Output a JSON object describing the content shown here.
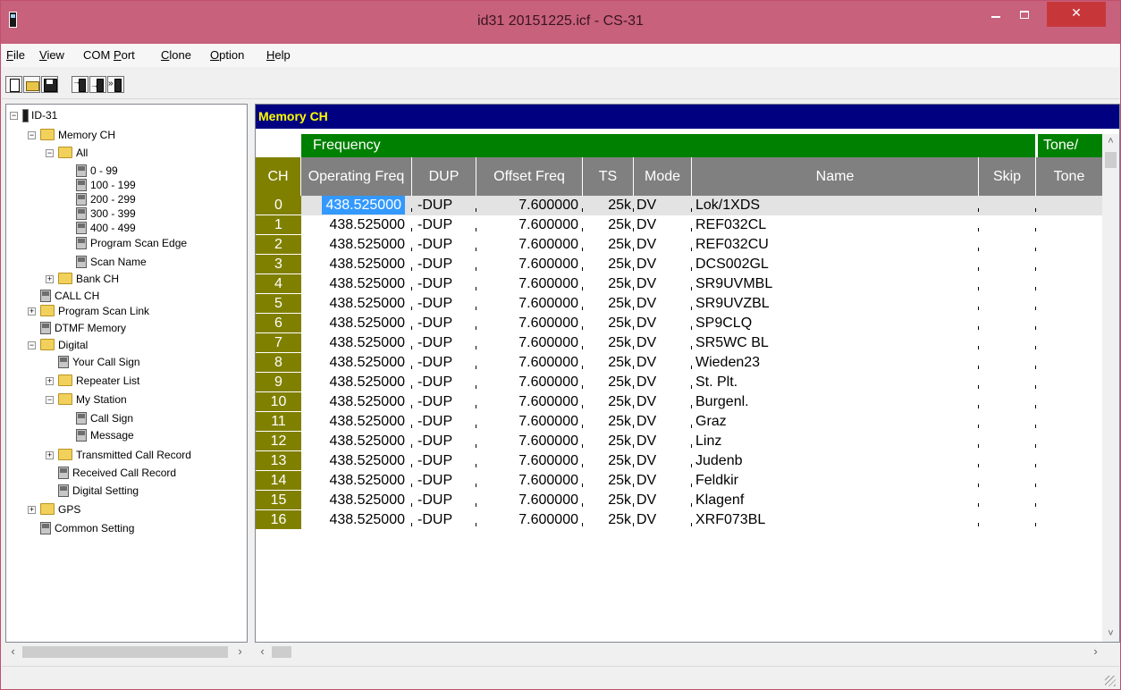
{
  "window": {
    "title": "id31 20151225.icf - CS-31"
  },
  "menu": [
    {
      "key": "F",
      "rest": "ile"
    },
    {
      "key": "V",
      "rest": "iew"
    },
    {
      "pre": "COM ",
      "key": "P",
      "rest": "ort"
    },
    {
      "key": "C",
      "rest": "lone"
    },
    {
      "key": "O",
      "rest": "ption"
    },
    {
      "key": "H",
      "rest": "elp"
    }
  ],
  "toolbar_icons": [
    "new-document-icon",
    "open-folder-icon",
    "save-disk-icon",
    "read-from-radio-icon",
    "write-to-radio-icon",
    "clone-radio-icon"
  ],
  "tree": [
    {
      "label": "ID-31",
      "icon": "radio",
      "expand": "-"
    },
    {
      "label": "Memory CH",
      "icon": "folder",
      "expand": "-"
    },
    {
      "label": "All",
      "icon": "folder",
      "expand": "-"
    },
    {
      "label": "0 - 99",
      "icon": "page"
    },
    {
      "label": "100 - 199",
      "icon": "page"
    },
    {
      "label": "200 - 299",
      "icon": "page"
    },
    {
      "label": "300 - 399",
      "icon": "page"
    },
    {
      "label": "400 - 499",
      "icon": "page"
    },
    {
      "label": "Program Scan Edge",
      "icon": "page"
    },
    {
      "label": "Scan Name",
      "icon": "page"
    },
    {
      "label": "Bank CH",
      "icon": "folder",
      "expand": "+"
    },
    {
      "label": "CALL CH",
      "icon": "page"
    },
    {
      "label": "Program Scan Link",
      "icon": "folder",
      "expand": "+"
    },
    {
      "label": "DTMF Memory",
      "icon": "page"
    },
    {
      "label": "Digital",
      "icon": "folder",
      "expand": "-"
    },
    {
      "label": "Your Call Sign",
      "icon": "page"
    },
    {
      "label": "Repeater List",
      "icon": "folder",
      "expand": "+"
    },
    {
      "label": "My Station",
      "icon": "folder",
      "expand": "-"
    },
    {
      "label": "Call Sign",
      "icon": "page"
    },
    {
      "label": "Message",
      "icon": "page"
    },
    {
      "label": "Transmitted Call Record",
      "icon": "folder",
      "expand": "+"
    },
    {
      "label": "Received Call Record",
      "icon": "page"
    },
    {
      "label": "Digital Setting",
      "icon": "page"
    },
    {
      "label": "GPS",
      "icon": "folder",
      "expand": "+"
    },
    {
      "label": "Common Setting",
      "icon": "page"
    }
  ],
  "panel": {
    "title": "Memory CH"
  },
  "grid": {
    "group_frequency": "Frequency",
    "group_tone": "Tone/",
    "columns": {
      "ch": "CH",
      "opfreq": "Operating Freq",
      "dup": "DUP",
      "offset": "Offset Freq",
      "ts": "TS",
      "mode": "Mode",
      "name": "Name",
      "skip": "Skip",
      "tone": "Tone"
    },
    "rows": [
      {
        "ch": "0",
        "freq": "438.525000",
        "dup": "-DUP",
        "offset": "7.600000",
        "ts": "25k",
        "mode": "DV",
        "name": "Lok/1XDS"
      },
      {
        "ch": "1",
        "freq": "438.525000",
        "dup": "-DUP",
        "offset": "7.600000",
        "ts": "25k",
        "mode": "DV",
        "name": "REF032CL"
      },
      {
        "ch": "2",
        "freq": "438.525000",
        "dup": "-DUP",
        "offset": "7.600000",
        "ts": "25k",
        "mode": "DV",
        "name": "REF032CU"
      },
      {
        "ch": "3",
        "freq": "438.525000",
        "dup": "-DUP",
        "offset": "7.600000",
        "ts": "25k",
        "mode": "DV",
        "name": "DCS002GL"
      },
      {
        "ch": "4",
        "freq": "438.525000",
        "dup": "-DUP",
        "offset": "7.600000",
        "ts": "25k",
        "mode": "DV",
        "name": "SR9UVMBL"
      },
      {
        "ch": "5",
        "freq": "438.525000",
        "dup": "-DUP",
        "offset": "7.600000",
        "ts": "25k",
        "mode": "DV",
        "name": "SR9UVZBL"
      },
      {
        "ch": "6",
        "freq": "438.525000",
        "dup": "-DUP",
        "offset": "7.600000",
        "ts": "25k",
        "mode": "DV",
        "name": "SP9CLQ"
      },
      {
        "ch": "7",
        "freq": "438.525000",
        "dup": "-DUP",
        "offset": "7.600000",
        "ts": "25k",
        "mode": "DV",
        "name": "SR5WC BL"
      },
      {
        "ch": "8",
        "freq": "438.525000",
        "dup": "-DUP",
        "offset": "7.600000",
        "ts": "25k",
        "mode": "DV",
        "name": "Wieden23"
      },
      {
        "ch": "9",
        "freq": "438.525000",
        "dup": "-DUP",
        "offset": "7.600000",
        "ts": "25k",
        "mode": "DV",
        "name": "St. Plt."
      },
      {
        "ch": "10",
        "freq": "438.525000",
        "dup": "-DUP",
        "offset": "7.600000",
        "ts": "25k",
        "mode": "DV",
        "name": "Burgenl."
      },
      {
        "ch": "11",
        "freq": "438.525000",
        "dup": "-DUP",
        "offset": "7.600000",
        "ts": "25k",
        "mode": "DV",
        "name": "Graz"
      },
      {
        "ch": "12",
        "freq": "438.525000",
        "dup": "-DUP",
        "offset": "7.600000",
        "ts": "25k",
        "mode": "DV",
        "name": "Linz"
      },
      {
        "ch": "13",
        "freq": "438.525000",
        "dup": "-DUP",
        "offset": "7.600000",
        "ts": "25k",
        "mode": "DV",
        "name": "Judenb"
      },
      {
        "ch": "14",
        "freq": "438.525000",
        "dup": "-DUP",
        "offset": "7.600000",
        "ts": "25k",
        "mode": "DV",
        "name": "Feldkir"
      },
      {
        "ch": "15",
        "freq": "438.525000",
        "dup": "-DUP",
        "offset": "7.600000",
        "ts": "25k",
        "mode": "DV",
        "name": "Klagenf"
      },
      {
        "ch": "16",
        "freq": "438.525000",
        "dup": "-DUP",
        "offset": "7.600000",
        "ts": "25k",
        "mode": "DV",
        "name": "XRF073BL"
      }
    ]
  },
  "colors": {
    "title_bar": "#c8617c",
    "panel_header": "#000080",
    "panel_header_text": "#ffff00",
    "group_header": "#008000",
    "ch_column": "#808000",
    "column_header": "#808080",
    "selection": "#3399ff"
  }
}
